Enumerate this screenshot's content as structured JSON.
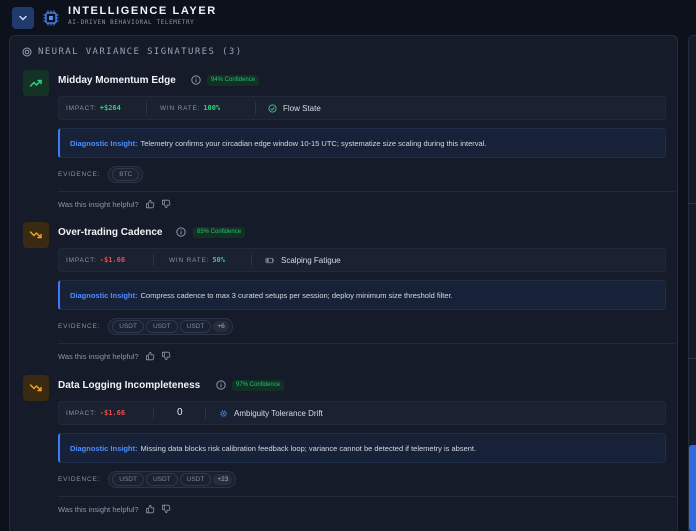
{
  "header": {
    "title": "INTELLIGENCE LAYER",
    "subtitle": "AI-DRIVEN BEHAVIORAL TELEMETRY"
  },
  "section": {
    "title": "NEURAL VARIANCE SIGNATURES (3)"
  },
  "labels": {
    "impact": "IMPACT:",
    "win_rate": "WIN RATE:",
    "diagnostic": "Diagnostic Insight:",
    "evidence": "EVIDENCE:",
    "helpful": "Was this insight helpful?"
  },
  "cards": [
    {
      "title": "Midday Momentum Edge",
      "trend": "up",
      "confidence": "94% Confidence",
      "impact": "+$264",
      "win_rate": "100%",
      "state": "Flow State",
      "state_icon": "check-circle-icon",
      "insight": "Telemetry confirms your circadian edge window 10-15 UTC; systematize size scaling during this interval.",
      "evidence": [
        "BTC"
      ],
      "evidence_more": ""
    },
    {
      "title": "Over-trading Cadence",
      "trend": "down",
      "confidence": "85% Confidence",
      "impact": "-$1.66",
      "win_rate": "50%",
      "state": "Scalping Fatigue",
      "state_icon": "battery-low-icon",
      "insight": "Compress cadence to max 3 curated setups per session; deploy minimum size threshold filter.",
      "evidence": [
        "USDT",
        "USDT",
        "USDT"
      ],
      "evidence_more": "+6"
    },
    {
      "title": "Data Logging Incompleteness",
      "trend": "down",
      "confidence": "97% Confidence",
      "impact": "-$1.66",
      "win_rate": "0",
      "state": "Ambiguity Tolerance Drift",
      "state_icon": "gear-icon",
      "insight": "Missing data blocks risk calibration feedback loop; variance cannot be detected if telemetry is absent.",
      "evidence": [
        "USDT",
        "USDT",
        "USDT"
      ],
      "evidence_more": "+23"
    }
  ],
  "colors": {
    "positive": "#2fd17e",
    "negative": "#ef4b4b",
    "accent": "#3a7bff",
    "warning": "#f0a020"
  }
}
